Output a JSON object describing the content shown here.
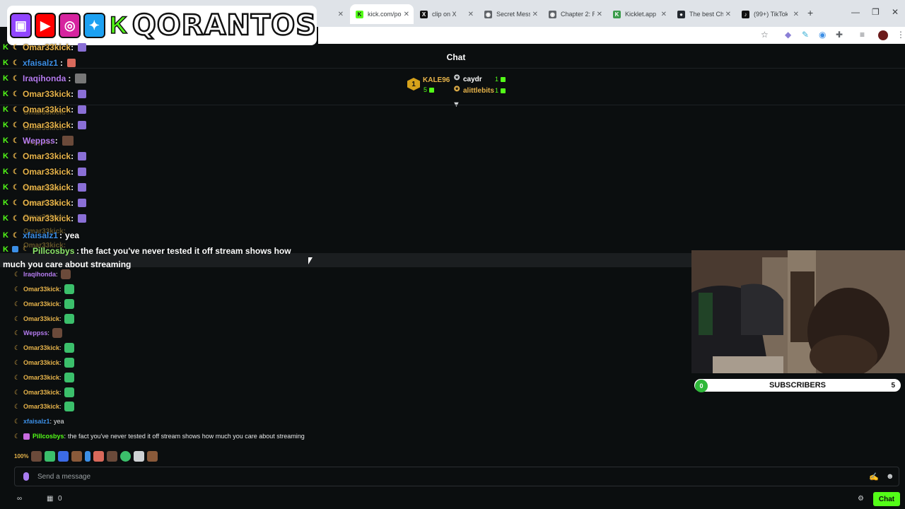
{
  "browser": {
    "tabs": [
      {
        "title": "kick.com/po",
        "active": true,
        "favicon": "kick-favicon",
        "color": "#53fc18"
      },
      {
        "title": "clip on X",
        "active": false,
        "favicon": "x-favicon",
        "color": "#000000"
      },
      {
        "title": "Secret Mess",
        "active": false,
        "favicon": "globe-favicon",
        "color": "#3c4043"
      },
      {
        "title": "Chapter 2: R",
        "active": false,
        "favicon": "globe-favicon",
        "color": "#3c4043"
      },
      {
        "title": "Kicklet.app",
        "active": false,
        "favicon": "kicklet-favicon",
        "color": "#3c4043"
      },
      {
        "title": "The best Ch",
        "active": false,
        "favicon": "github-favicon",
        "color": "#3c4043"
      },
      {
        "title": "(99+) TikTok",
        "active": false,
        "favicon": "tiktok-favicon",
        "color": "#000000"
      }
    ]
  },
  "overlay": {
    "brand": "QORANTOS",
    "socials": [
      "twitch-icon",
      "youtube-icon",
      "instagram-icon",
      "twitter-icon",
      "kick-icon"
    ],
    "chat": [
      {
        "name": "Omar33kick",
        "sep": ":",
        "color": "#e6b34a",
        "text": ""
      },
      {
        "name": "xfaisalz1",
        "sep": ":",
        "color": "#3c8fe6",
        "text": ""
      },
      {
        "name": "Iraqihonda",
        "sep": ":",
        "color": "#b57cf0",
        "text": ""
      },
      {
        "name": "Omar33kick",
        "sep": ":",
        "color": "#e6b34a",
        "text": ""
      },
      {
        "name": "Omar33kick",
        "sep": ":",
        "color": "#e6b34a",
        "text": ""
      },
      {
        "name": "Omar33kick",
        "sep": ":",
        "color": "#e6b34a",
        "text": ""
      },
      {
        "name": "Weppss",
        "sep": ":",
        "color": "#b57cf0",
        "text": ""
      },
      {
        "name": "Omar33kick",
        "sep": ":",
        "color": "#e6b34a",
        "text": ""
      },
      {
        "name": "Omar33kick",
        "sep": ":",
        "color": "#e6b34a",
        "text": ""
      },
      {
        "name": "Omar33kick",
        "sep": ":",
        "color": "#e6b34a",
        "text": ""
      },
      {
        "name": "Omar33kick",
        "sep": ":",
        "color": "#e6b34a",
        "text": ""
      },
      {
        "name": "Omar33kick",
        "sep": ":",
        "color": "#e6b34a",
        "text": ""
      },
      {
        "name": "xfaisalz1",
        "sep": ":",
        "color": "#3c8fe6",
        "text": "yea"
      }
    ],
    "highlight": {
      "name": "Pillcosbys",
      "line1": "the fact you've never tested it off stream shows how",
      "line2": "much you care about streaming"
    }
  },
  "chat": {
    "title": "Chat",
    "leaderboard": {
      "top": {
        "rank": "1",
        "name": "KALE96",
        "count": "5"
      },
      "others": [
        {
          "name": "caydr",
          "count": "1",
          "color": "#ffffff"
        },
        {
          "name": "alittlebits",
          "count": "1",
          "color": "#e6b34a"
        }
      ]
    },
    "messages": [
      {
        "name": "Iraqihonda",
        "color": "#b57cf0",
        "emote": "face",
        "text": ""
      },
      {
        "name": "Omar33kick",
        "color": "#e6b34a",
        "emote": "green",
        "text": ""
      },
      {
        "name": "Omar33kick",
        "color": "#e6b34a",
        "emote": "green",
        "text": ""
      },
      {
        "name": "Omar33kick",
        "color": "#e6b34a",
        "emote": "green",
        "text": ""
      },
      {
        "name": "Weppss",
        "color": "#b57cf0",
        "emote": "face",
        "text": ""
      },
      {
        "name": "Omar33kick",
        "color": "#e6b34a",
        "emote": "green",
        "text": ""
      },
      {
        "name": "Omar33kick",
        "color": "#e6b34a",
        "emote": "green",
        "text": ""
      },
      {
        "name": "Omar33kick",
        "color": "#e6b34a",
        "emote": "green",
        "text": ""
      },
      {
        "name": "Omar33kick",
        "color": "#e6b34a",
        "emote": "green",
        "text": ""
      },
      {
        "name": "Omar33kick",
        "color": "#e6b34a",
        "emote": "green",
        "text": ""
      },
      {
        "name": "xfaisalz1",
        "color": "#3c8fe6",
        "emote": "",
        "text": "yea"
      },
      {
        "name": "Pillcosbys",
        "color": "#53fc18",
        "emote": "",
        "text": "the fact you've never tested it off stream shows how much you care about streaming",
        "sub": true
      }
    ],
    "emote_strip_first": "100%",
    "input_placeholder": "Send a message",
    "send_label": "Chat",
    "points_count": "0"
  },
  "subs": {
    "current": "0",
    "label": "SUBSCRIBERS",
    "goal": "5"
  },
  "colors": {
    "kick_green": "#53fc18",
    "background": "#0b0e0f"
  }
}
